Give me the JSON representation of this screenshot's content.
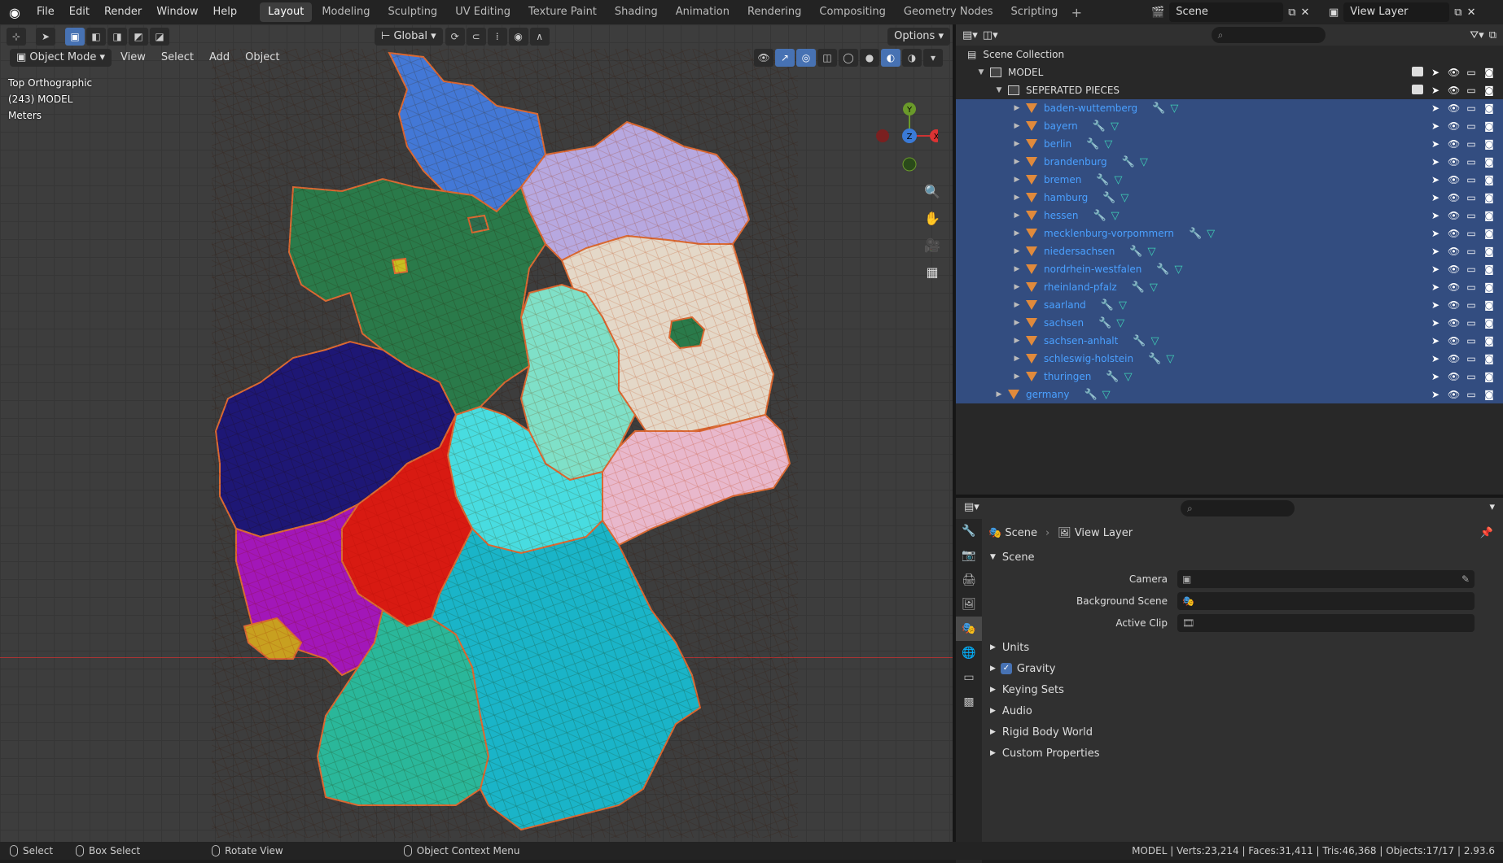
{
  "topbar": {
    "menus": [
      "File",
      "Edit",
      "Render",
      "Window",
      "Help"
    ],
    "workspaces": [
      "Layout",
      "Modeling",
      "Sculpting",
      "UV Editing",
      "Texture Paint",
      "Shading",
      "Animation",
      "Rendering",
      "Compositing",
      "Geometry Nodes",
      "Scripting"
    ],
    "active_workspace": "Layout",
    "add": "+",
    "scene": "Scene",
    "view_layer": "View Layer"
  },
  "viewport": {
    "mode": "Object Mode",
    "menus": [
      "View",
      "Select",
      "Add",
      "Object"
    ],
    "transform": "Global",
    "options": "Options",
    "overlay": {
      "view": "Top Orthographic",
      "collection": "(243) MODEL",
      "units": "Meters"
    },
    "gizmo": {
      "y": "Y",
      "z": "Z",
      "x": "X"
    },
    "colors": {
      "bw": "#1e1775",
      "rp": "#a217b8",
      "he": "#d81a12",
      "bb": "#2ab79a",
      "by": "#1ab4c8",
      "nrw": "#2e6b4d",
      "ns": "#2a7a4a",
      "sh": "#4378d6",
      "mv": "#b7a8e0",
      "bbg": "#e4d8c8",
      "st": "#7fe0c8",
      "th": "#48dce0",
      "sn": "#e8b8cc",
      "wire": "#d96a33"
    }
  },
  "outliner": {
    "search_placeholder": "",
    "root": "Scene Collection",
    "model": "MODEL",
    "separated": "SEPERATED PIECES",
    "items": [
      "baden-wuttemberg",
      "bayern",
      "berlin",
      "brandenburg",
      "bremen",
      "hamburg",
      "hessen",
      "mecklenburg-vorpommern",
      "niedersachsen",
      "nordrhein-westfalen",
      "rheinland-pfalz",
      "saarland",
      "sachsen",
      "sachsen-anhalt",
      "schleswig-holstein",
      "thuringen"
    ],
    "germany": "germany"
  },
  "properties": {
    "breadcrumb_scene": "Scene",
    "breadcrumb_layer": "View Layer",
    "panel": "Scene",
    "fields": [
      {
        "label": "Camera"
      },
      {
        "label": "Background Scene"
      },
      {
        "label": "Active Clip"
      }
    ],
    "subpanels": [
      "Units",
      "Gravity",
      "Keying Sets",
      "Audio",
      "Rigid Body World",
      "Custom Properties"
    ]
  },
  "statusbar": {
    "select": "Select",
    "box_select": "Box Select",
    "rotate": "Rotate View",
    "context": "Object Context Menu",
    "stats": "MODEL | Verts:23,214 | Faces:31,411 | Tris:46,368 | Objects:17/17 | 2.93.6"
  }
}
